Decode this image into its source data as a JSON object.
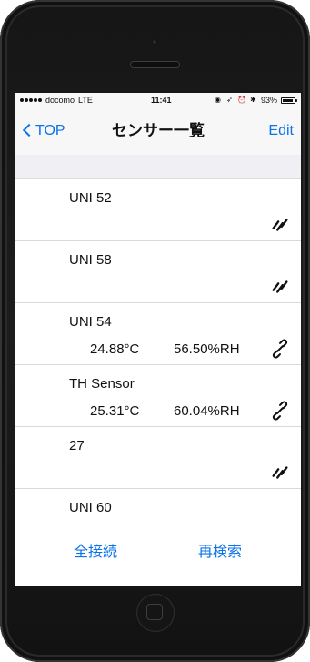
{
  "status_bar": {
    "carrier": "docomo",
    "network": "LTE",
    "time": "11:41",
    "battery_percent": "93%",
    "battery_level": 93,
    "icons": [
      "signal-dots-icon",
      "location-icon",
      "alarm-icon",
      "bluetooth-icon",
      "battery-icon"
    ]
  },
  "nav": {
    "back_label": "TOP",
    "title": "センサー一覧",
    "edit_label": "Edit",
    "accent_color": "#0a73e8"
  },
  "sensors": [
    {
      "name": "UNI 52",
      "temperature": "",
      "humidity": "",
      "status_icon": "disconnected-link-icon"
    },
    {
      "name": "UNI 58",
      "temperature": "",
      "humidity": "",
      "status_icon": "disconnected-link-icon"
    },
    {
      "name": "UNI 54",
      "temperature": "24.88°C",
      "humidity": "56.50%RH",
      "status_icon": "connected-link-icon"
    },
    {
      "name": "TH Sensor",
      "temperature": "25.31°C",
      "humidity": "60.04%RH",
      "status_icon": "connected-link-icon"
    },
    {
      "name": "27",
      "temperature": "",
      "humidity": "",
      "status_icon": "disconnected-link-icon"
    },
    {
      "name": "UNI 60",
      "temperature": "",
      "humidity": "",
      "status_icon": "disconnected-link-icon"
    }
  ],
  "footer": {
    "connect_all_label": "全接続",
    "research_label": "再検索"
  }
}
